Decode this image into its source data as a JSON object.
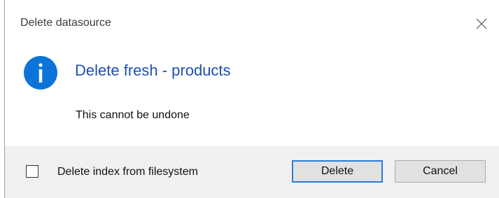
{
  "dialog": {
    "title": "Delete datasource",
    "heading": "Delete fresh - products",
    "message": "This cannot be undone",
    "icon": "info-icon",
    "accent_color": "#1e4fb0",
    "icon_color": "#0a74d9"
  },
  "footer": {
    "checkbox_label": "Delete index from filesystem",
    "checkbox_checked": false,
    "delete_label": "Delete",
    "cancel_label": "Cancel"
  }
}
